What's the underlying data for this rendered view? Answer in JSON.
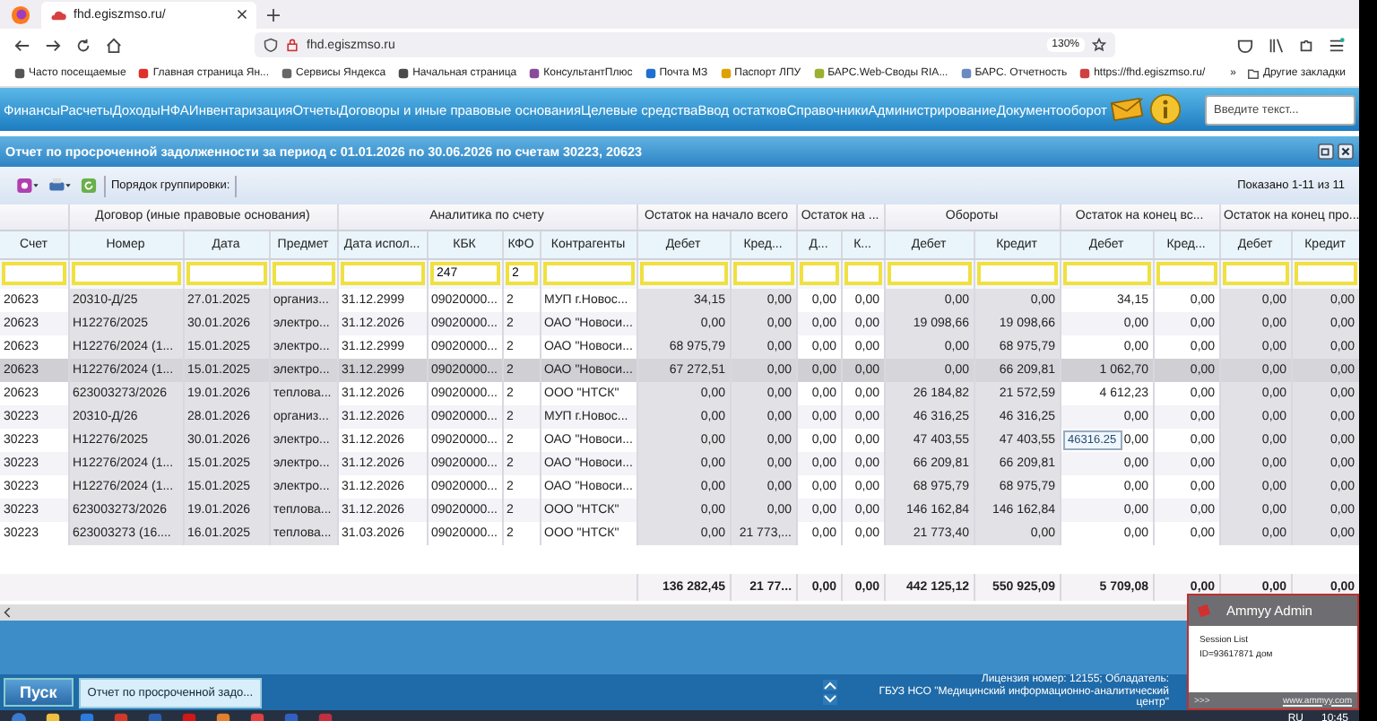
{
  "browser": {
    "tab": {
      "title": "fhd.egiszmso.ru/"
    },
    "address": "fhd.egiszmso.ru",
    "zoom": "130%",
    "bookmarks": [
      {
        "label": "Часто посещаемые",
        "color": "#555555"
      },
      {
        "label": "Главная страница Ян...",
        "color": "#e0302a"
      },
      {
        "label": "Сервисы Яндекса",
        "color": "#666666"
      },
      {
        "label": "Начальная страница",
        "color": "#4a4a4a"
      },
      {
        "label": "КонсультантПлюс",
        "color": "#8a4a9a"
      },
      {
        "label": "Почта МЗ",
        "color": "#1e6fd0"
      },
      {
        "label": "Паспорт ЛПУ",
        "color": "#e0a000"
      },
      {
        "label": "БАРС.Web-Своды RIA...",
        "color": "#9ab030"
      },
      {
        "label": "БАРС. Отчетность",
        "color": "#6a8ac0"
      },
      {
        "label": "https://fhd.egiszmso.ru/",
        "color": "#d04040"
      }
    ],
    "more": "»",
    "other_bookmarks": "Другие закладки"
  },
  "app": {
    "menu": [
      "Финансы",
      "Расчеты",
      "Доходы",
      "НФА",
      "Инвентаризация",
      "Отчеты",
      "Договоры и иные правовые основания",
      "Целевые средства",
      "Ввод остатков",
      "Справочники",
      "Администрирование",
      "Документооборот"
    ],
    "search": {
      "placeholder": "Введите текст..."
    },
    "window_title": "Отчет по просроченной задолженности за период с 01.01.2026 по 30.06.2026 по счетам 30223, 20623",
    "grouping_label": "Порядок группировки:",
    "shown": "Показано 1-11 из 11"
  },
  "table": {
    "column_groups": [
      {
        "columns": [
          {
            "label": "Счет",
            "kind": "text",
            "shaded": false
          }
        ]
      },
      {
        "label": "Договор (иные правовые основания)",
        "columns": [
          {
            "label": "Номер",
            "kind": "text",
            "shaded": true
          },
          {
            "label": "Дата",
            "kind": "text",
            "shaded": true
          },
          {
            "label": "Предмет",
            "kind": "text",
            "shaded": true
          }
        ]
      },
      {
        "label": "Аналитика по счету",
        "columns": [
          {
            "label": "Дата испол...",
            "kind": "text",
            "shaded": false
          },
          {
            "label": "КБК",
            "kind": "text",
            "shaded": false,
            "filter": "247"
          },
          {
            "label": "КФО",
            "kind": "text",
            "shaded": false,
            "filter": "2"
          },
          {
            "label": "Контрагенты",
            "kind": "text",
            "shaded": false
          }
        ]
      },
      {
        "label": "Остаток на начало всего",
        "columns": [
          {
            "label": "Дебет",
            "kind": "number",
            "shaded": true
          },
          {
            "label": "Кред...",
            "kind": "number",
            "shaded": true
          }
        ]
      },
      {
        "label": "Остаток на ...",
        "columns": [
          {
            "label": "Д...",
            "kind": "number",
            "shaded": false
          },
          {
            "label": "К...",
            "kind": "number",
            "shaded": false
          }
        ]
      },
      {
        "label": "Обороты",
        "columns": [
          {
            "label": "Дебет",
            "kind": "number",
            "shaded": true
          },
          {
            "label": "Кредит",
            "kind": "number",
            "shaded": true
          }
        ]
      },
      {
        "label": "Остаток на конец вс...",
        "columns": [
          {
            "label": "Дебет",
            "kind": "number",
            "shaded": false
          },
          {
            "label": "Кред...",
            "kind": "number",
            "shaded": false
          }
        ]
      },
      {
        "label": "Остаток на конец про...",
        "columns": [
          {
            "label": "Дебет",
            "kind": "number",
            "shaded": true
          },
          {
            "label": "Кредит",
            "kind": "number",
            "shaded": true
          }
        ]
      }
    ],
    "rows": [
      {
        "selected": false,
        "cells": [
          "20623",
          "20310-Д/25",
          "27.01.2025",
          "организ...",
          "31.12.2999",
          "09020000...",
          "2",
          "МУП г.Новос...",
          "34,15",
          "0,00",
          "0,00",
          "0,00",
          "0,00",
          "0,00",
          "34,15",
          "0,00",
          "0,00",
          "0,00"
        ]
      },
      {
        "selected": false,
        "cells": [
          "20623",
          "Н12276/2025",
          "30.01.2026",
          "электро...",
          "31.12.2026",
          "09020000...",
          "2",
          "ОАО \"Новоси...",
          "0,00",
          "0,00",
          "0,00",
          "0,00",
          "19 098,66",
          "19 098,66",
          "0,00",
          "0,00",
          "0,00",
          "0,00"
        ]
      },
      {
        "selected": false,
        "cells": [
          "20623",
          "Н12276/2024 (1...",
          "15.01.2025",
          "электро...",
          "31.12.2999",
          "09020000...",
          "2",
          "ОАО \"Новоси...",
          "68 975,79",
          "0,00",
          "0,00",
          "0,00",
          "0,00",
          "68 975,79",
          "0,00",
          "0,00",
          "0,00",
          "0,00"
        ]
      },
      {
        "selected": true,
        "cells": [
          "20623",
          "Н12276/2024 (1...",
          "15.01.2025",
          "электро...",
          "31.12.2999",
          "09020000...",
          "2",
          "ОАО \"Новоси...",
          "67 272,51",
          "0,00",
          "0,00",
          "0,00",
          "0,00",
          "66 209,81",
          "1 062,70",
          "0,00",
          "0,00",
          "0,00"
        ]
      },
      {
        "selected": false,
        "cells": [
          "20623",
          "623003273/2026",
          "19.01.2026",
          "теплова...",
          "31.12.2026",
          "09020000...",
          "2",
          "ООО \"НТСК\"",
          "0,00",
          "0,00",
          "0,00",
          "0,00",
          "26 184,82",
          "21 572,59",
          "4 612,23",
          "0,00",
          "0,00",
          "0,00"
        ]
      },
      {
        "selected": false,
        "cells": [
          "30223",
          "20310-Д/26",
          "28.01.2026",
          "организ...",
          "31.12.2026",
          "09020000...",
          "2",
          "МУП г.Новос...",
          "0,00",
          "0,00",
          "0,00",
          "0,00",
          "46 316,25",
          "46 316,25",
          "0,00",
          "0,00",
          "0,00",
          "0,00"
        ]
      },
      {
        "selected": false,
        "cells": [
          "30223",
          "Н12276/2025",
          "30.01.2026",
          "электро...",
          "31.12.2026",
          "09020000...",
          "2",
          "ОАО \"Новоси...",
          "0,00",
          "0,00",
          "0,00",
          "0,00",
          "47 403,55",
          "47 403,55",
          {
            "text": "0,00",
            "tooltip": "46316.25"
          },
          "0,00",
          "0,00",
          "0,00"
        ]
      },
      {
        "selected": false,
        "cells": [
          "30223",
          "Н12276/2024 (1...",
          "15.01.2025",
          "электро...",
          "31.12.2026",
          "09020000...",
          "2",
          "ОАО \"Новоси...",
          "0,00",
          "0,00",
          "0,00",
          "0,00",
          "66 209,81",
          "66 209,81",
          "0,00",
          "0,00",
          "0,00",
          "0,00"
        ]
      },
      {
        "selected": false,
        "cells": [
          "30223",
          "Н12276/2024 (1...",
          "15.01.2025",
          "электро...",
          "31.12.2026",
          "09020000...",
          "2",
          "ОАО \"Новоси...",
          "0,00",
          "0,00",
          "0,00",
          "0,00",
          "68 975,79",
          "68 975,79",
          "0,00",
          "0,00",
          "0,00",
          "0,00"
        ]
      },
      {
        "selected": false,
        "cells": [
          "30223",
          "623003273/2026",
          "19.01.2026",
          "теплова...",
          "31.12.2026",
          "09020000...",
          "2",
          "ООО \"НТСК\"",
          "0,00",
          "0,00",
          "0,00",
          "0,00",
          "146 162,84",
          "146 162,84",
          "0,00",
          "0,00",
          "0,00",
          "0,00"
        ]
      },
      {
        "selected": false,
        "cells": [
          "30223",
          "623003273 (16....",
          "16.01.2025",
          "теплова...",
          "31.03.2026",
          "09020000...",
          "2",
          "ООО \"НТСК\"",
          "0,00",
          "21 773,...",
          "0,00",
          "0,00",
          "21 773,40",
          "0,00",
          "0,00",
          "0,00",
          "0,00",
          "0,00"
        ]
      }
    ],
    "totals": [
      "136 282,45",
      "21 77...",
      "0,00",
      "0,00",
      "442 125,12",
      "550 925,09",
      "5 709,08",
      "0,00",
      "0,00",
      "0,00"
    ]
  },
  "bottom": {
    "start": "Пуск",
    "task": "Отчет по просроченной задо...",
    "license": [
      "Лицензия номер: 12155; Обладатель:",
      "ГБУЗ НСО \"Медицинский информационно-аналитический",
      "центр\""
    ]
  },
  "popup": {
    "title": "Ammyy Admin",
    "lines": [
      "Session List",
      "ID=93617871 дом"
    ],
    "more": ">>>",
    "link": "www.ammyy.com"
  },
  "tray": {
    "language": "RU",
    "time": "10:45"
  }
}
